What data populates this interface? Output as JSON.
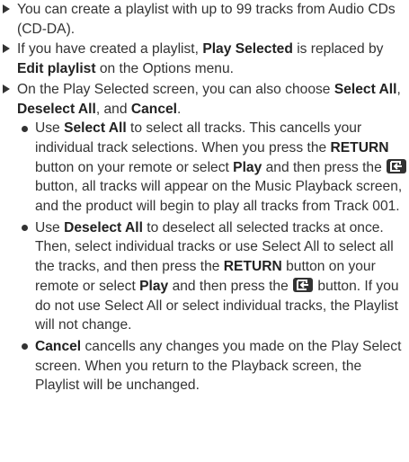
{
  "items": [
    {
      "parts": [
        "You can create a playlist with up to 99 tracks from Audio CDs (CD-DA)."
      ]
    },
    {
      "parts": [
        "If you have created a playlist, ",
        "Play Selected",
        " is replaced by ",
        "Edit playlist",
        " on the Options menu."
      ]
    },
    {
      "parts": [
        "On the Play Selected screen, you can also choose ",
        "Select All",
        ", ",
        "Deselect All",
        ", and ",
        "Cancel",
        "."
      ]
    }
  ],
  "subitems": [
    {
      "parts": [
        "Use ",
        "Select All",
        " to select all tracks. This cancells your individual track selections. When you press the ",
        "RETURN",
        " button on your remote or select ",
        "Play",
        " and then press the ",
        " button, all tracks will appear on the Music Playback screen, and the product will begin to play all tracks from Track 001."
      ]
    },
    {
      "parts": [
        "Use ",
        "Deselect All",
        " to deselect all selected tracks at once. Then, select individual tracks or use Select All to select all the tracks, and then press the ",
        "RETURN",
        " button on your remote or select ",
        "Play",
        " and then press the ",
        " button. If you do not use Select All or select individual tracks, the Playlist will not change."
      ]
    },
    {
      "parts": [
        "Cancel",
        " cancells any changes you made on the Play Select screen. When you return to the Playback screen, the Playlist will be unchanged."
      ]
    }
  ]
}
